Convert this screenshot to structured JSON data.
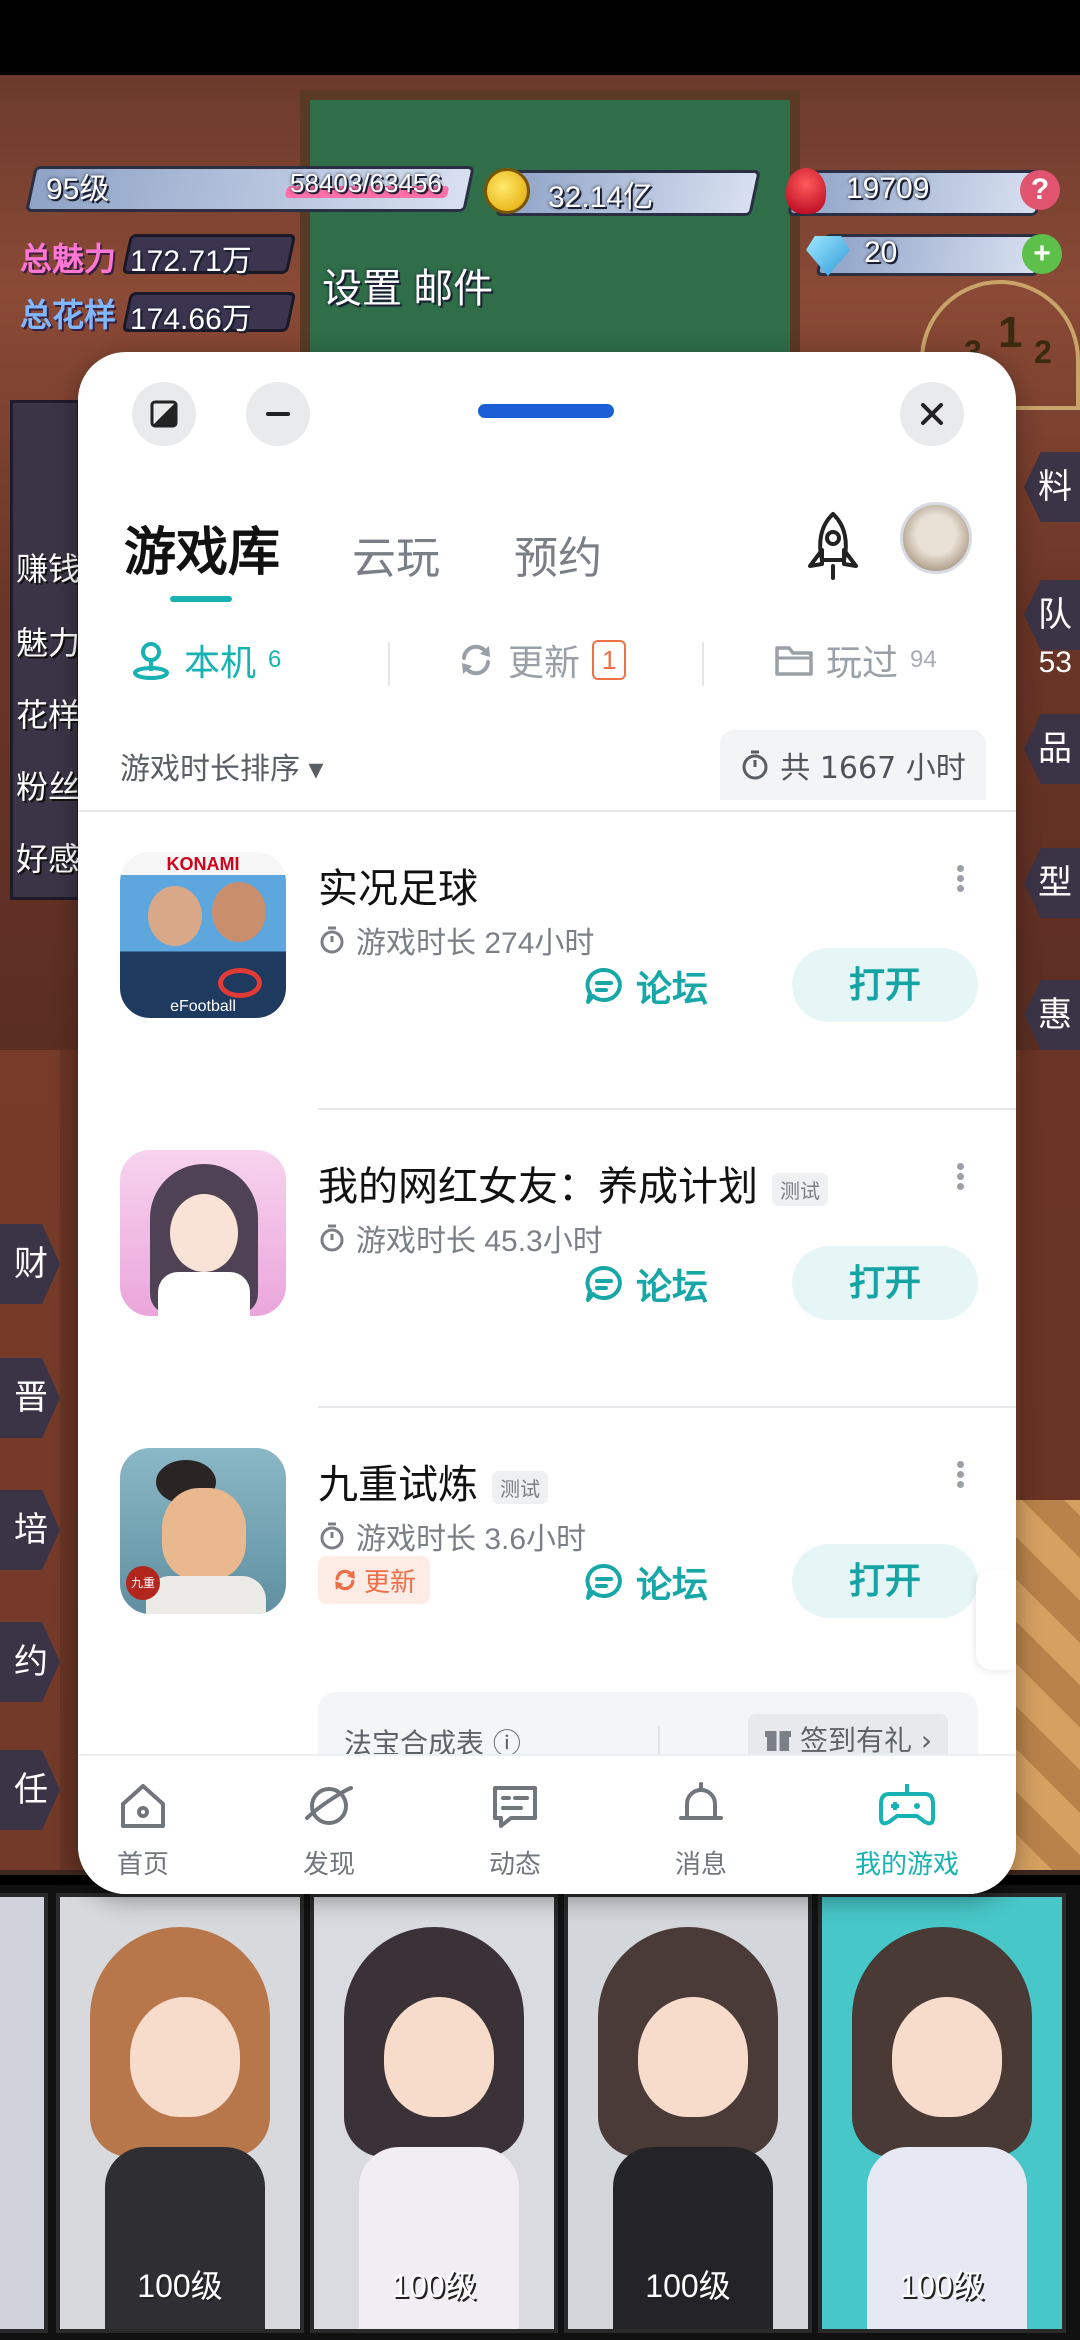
{
  "game_hud": {
    "level": "95级",
    "exp": "58403/63456",
    "exp_progress": 0.92,
    "gold": "32.14亿",
    "roses": "19709",
    "diamonds": "20",
    "charm_label": "总魅力",
    "charm_value": "172.71万",
    "pattern_label": "总花样",
    "pattern_value": "174.66万",
    "settings_mail": "设置 邮件",
    "help_icon": "?",
    "add_icon": "+",
    "podium": [
      "3",
      "1",
      "2"
    ],
    "side_menu": [
      "赚钱",
      "魅力",
      "花样",
      "粉丝",
      "好感"
    ],
    "left_tabs": [
      "财",
      "晋",
      "培",
      "约",
      "任"
    ],
    "right_tabs": [
      "料",
      "队",
      "53",
      "品",
      "型",
      "惠"
    ],
    "characters": [
      {
        "level": "100级"
      },
      {
        "level": "100级"
      },
      {
        "level": "100级"
      },
      {
        "level": "100级"
      }
    ]
  },
  "panel": {
    "tabs": [
      {
        "label": "游戏库",
        "active": true
      },
      {
        "label": "云玩",
        "active": false
      },
      {
        "label": "预约",
        "active": false
      }
    ],
    "subtabs": {
      "local": {
        "label": "本机",
        "count": "6"
      },
      "update": {
        "label": "更新",
        "count": "1"
      },
      "played": {
        "label": "玩过",
        "count": "94"
      }
    },
    "sort_label": "游戏时长排序 ▾",
    "total_time": "共 1667 小时",
    "games": [
      {
        "title": "实况足球",
        "tag": "",
        "time": "游戏时长 274小时",
        "forum": "论坛",
        "open": "打开",
        "update": "",
        "icon_text": "KONAMI",
        "icon_sub": "eFootball"
      },
      {
        "title": "我的网红女友：养成计划",
        "tag": "测试",
        "time": "游戏时长 45.3小时",
        "forum": "论坛",
        "open": "打开",
        "update": "",
        "icon_text": "",
        "icon_sub": ""
      },
      {
        "title": "九重试炼",
        "tag": "测试",
        "time": "游戏时长 3.6小时",
        "forum": "论坛",
        "open": "打开",
        "update": "更新",
        "icon_text": "九重",
        "icon_sub": ""
      }
    ],
    "extras": {
      "left": "法宝合成表 ⓘ",
      "right": "签到有礼 ›"
    },
    "nav": [
      {
        "label": "首页",
        "icon": "home-icon"
      },
      {
        "label": "发现",
        "icon": "discover-icon"
      },
      {
        "label": "动态",
        "icon": "feed-icon"
      },
      {
        "label": "消息",
        "icon": "bell-icon"
      },
      {
        "label": "我的游戏",
        "icon": "gamepad-icon",
        "active": true
      }
    ]
  },
  "colors": {
    "accent": "#17b2b2",
    "handle": "#1a5fd6",
    "update": "#f07244"
  }
}
